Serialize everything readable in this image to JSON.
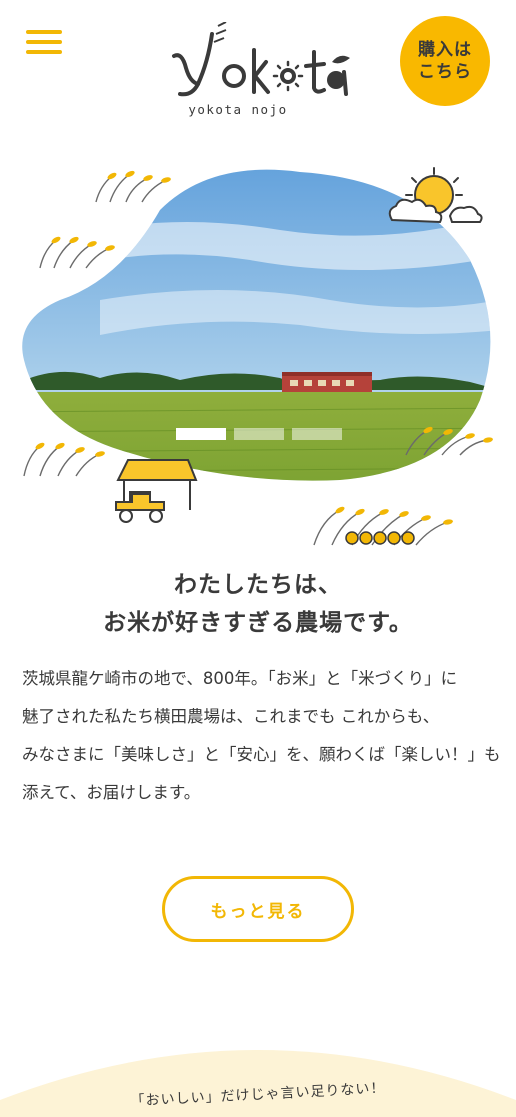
{
  "header": {
    "menu_icon": "hamburger-menu-icon",
    "logo_text": "yokota",
    "logo_sub": "yokota nojo",
    "buy_button": "購入は\nこちら"
  },
  "hero": {
    "slides_total": 3,
    "active_slide": 1
  },
  "intro": {
    "headline_line1": "わたしたちは、",
    "headline_line2": "お米が好きすぎる農場です。",
    "body_lines": [
      "茨城県龍ケ崎市の地で、800年。「お米」と「米づくり」に",
      "魅了された私たち横田農場は、これまでも これからも、",
      "みなさまに「美味しさ」と「安心」を、願わくば「楽しい！」も",
      "添えて、お届けします。"
    ],
    "more_button": "もっと見る"
  },
  "footer_teaser": {
    "tagline": "「おいしい」だけじゃ言い足りない！"
  },
  "colors": {
    "accent": "#f2b705",
    "buy_bg": "#f9b800",
    "text": "#3a3a3a",
    "arc_bg": "#fdf3d6"
  }
}
